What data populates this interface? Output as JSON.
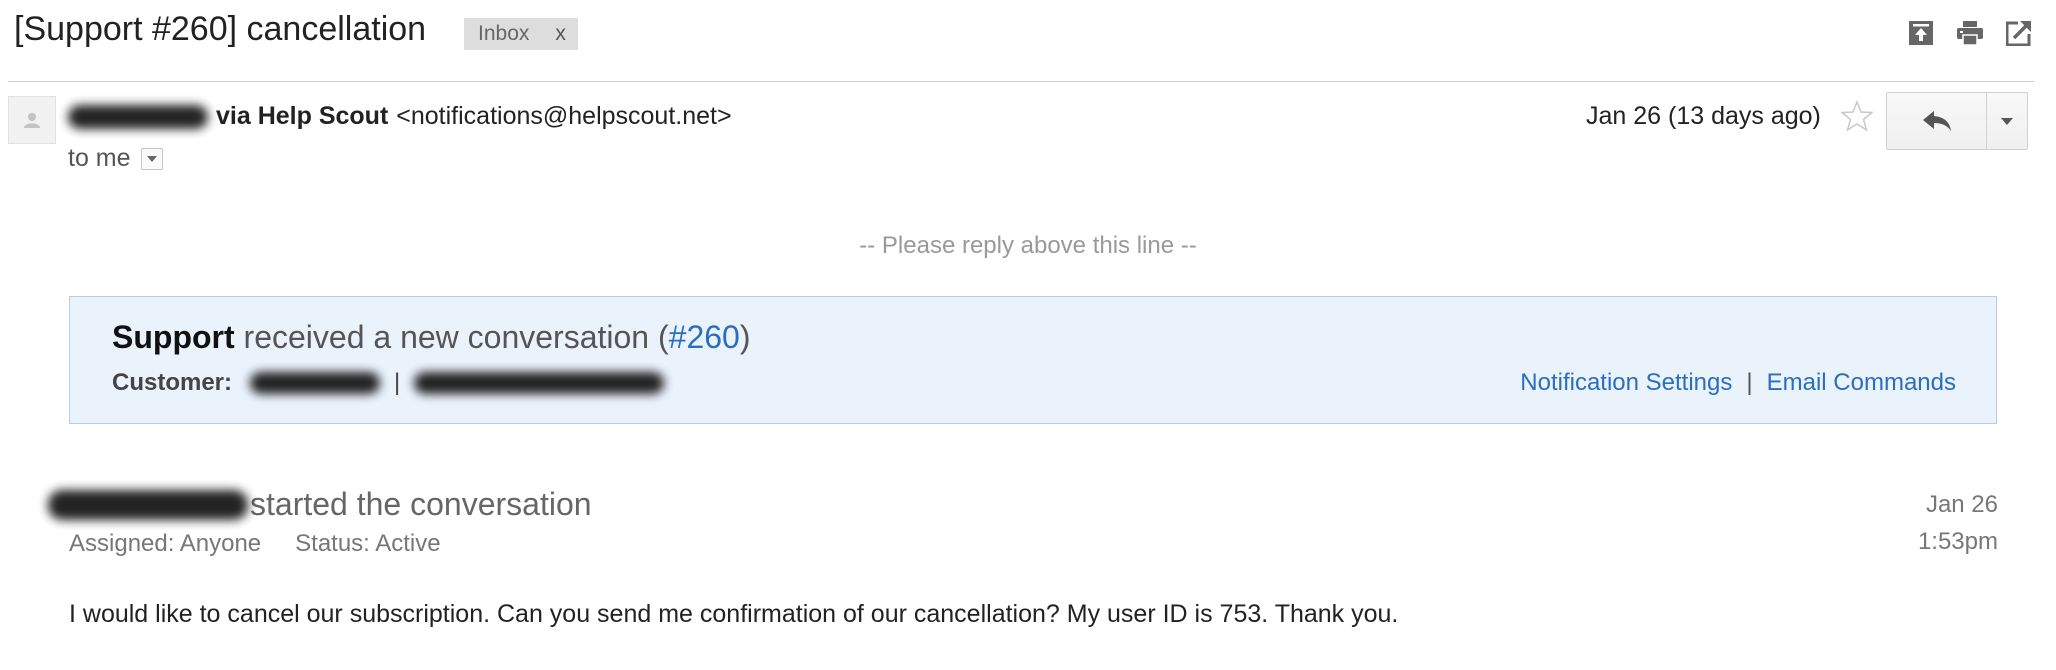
{
  "header": {
    "subject": "[Support #260] cancellation",
    "label": "Inbox",
    "label_remove": "x",
    "icons": [
      "archive-icon",
      "print-icon",
      "new-window-icon"
    ]
  },
  "sender": {
    "via": "via Help Scout",
    "email": "<notifications@helpscout.net>",
    "to": "to me",
    "date": "Jan 26 (13 days ago)"
  },
  "body": {
    "reply_line": "-- Please reply above this line --",
    "notice": {
      "team": "Support",
      "text": "received a new conversation (",
      "ticket": "#260",
      "close": ")",
      "customer_label": "Customer:",
      "separator": "|",
      "notification_settings": "Notification Settings",
      "link_separator": "|",
      "email_commands": "Email Commands"
    },
    "conversation": {
      "started": "started the conversation",
      "assigned": "Assigned: Anyone",
      "status": "Status: Active",
      "date": "Jan 26",
      "time": "1:53pm",
      "message": "I would like to cancel our subscription. Can you send me confirmation of our cancellation? My user ID is 753. Thank you."
    }
  },
  "colors": {
    "link": "#2a6ec0",
    "notice_bg": "#eaf2fc",
    "notice_border": "#b7cde7",
    "label_bg": "#dddddd"
  }
}
